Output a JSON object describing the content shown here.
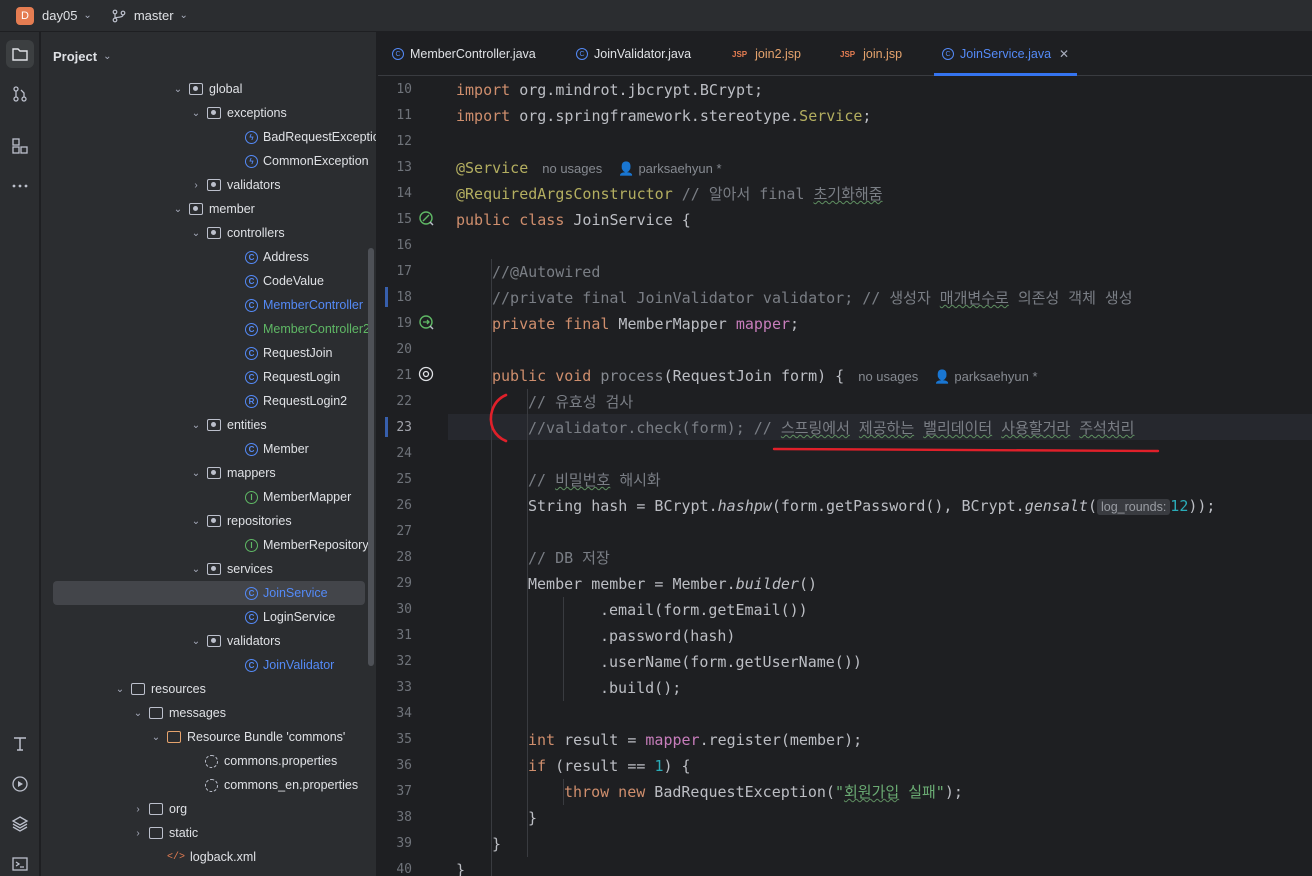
{
  "titlebar": {
    "project_badge": "D",
    "project_name": "day05",
    "branch": "master"
  },
  "leftbar": {
    "icons": [
      "folder-icon",
      "commit-icon",
      "structure-icon",
      "more-icon",
      "text-icon",
      "run-icon",
      "layers-icon",
      "terminal-icon"
    ]
  },
  "project_panel": {
    "title": "Project",
    "items": [
      {
        "label": "global",
        "type": "package",
        "expanded": true
      },
      {
        "label": "exceptions",
        "type": "package",
        "expanded": true
      },
      {
        "label": "BadRequestException",
        "type": "exception"
      },
      {
        "label": "CommonException",
        "type": "exception"
      },
      {
        "label": "validators",
        "type": "package",
        "expanded": false
      },
      {
        "label": "member",
        "type": "package",
        "expanded": true
      },
      {
        "label": "controllers",
        "type": "package",
        "expanded": true
      },
      {
        "label": "Address",
        "type": "class"
      },
      {
        "label": "CodeValue",
        "type": "class"
      },
      {
        "label": "MemberController",
        "type": "class",
        "color": "#548af7"
      },
      {
        "label": "MemberController2",
        "type": "class",
        "color": "#5fb865"
      },
      {
        "label": "RequestJoin",
        "type": "class"
      },
      {
        "label": "RequestLogin",
        "type": "class"
      },
      {
        "label": "RequestLogin2",
        "type": "record"
      },
      {
        "label": "entities",
        "type": "package",
        "expanded": true
      },
      {
        "label": "Member",
        "type": "class"
      },
      {
        "label": "mappers",
        "type": "package",
        "expanded": true
      },
      {
        "label": "MemberMapper",
        "type": "interface"
      },
      {
        "label": "repositories",
        "type": "package",
        "expanded": true
      },
      {
        "label": "MemberRepository",
        "type": "interface"
      },
      {
        "label": "services",
        "type": "package",
        "expanded": true
      },
      {
        "label": "JoinService",
        "type": "class",
        "color": "#548af7",
        "selected": true
      },
      {
        "label": "LoginService",
        "type": "class"
      },
      {
        "label": "validators",
        "type": "package",
        "expanded": true
      },
      {
        "label": "JoinValidator",
        "type": "class",
        "color": "#548af7"
      },
      {
        "label": "resources",
        "type": "folder",
        "expanded": true
      },
      {
        "label": "messages",
        "type": "folder",
        "expanded": true
      },
      {
        "label": "Resource Bundle 'commons'",
        "type": "bundle",
        "expanded": true
      },
      {
        "label": "commons.properties",
        "type": "properties"
      },
      {
        "label": "commons_en.properties",
        "type": "properties"
      },
      {
        "label": "org",
        "type": "folder",
        "expanded": false
      },
      {
        "label": "static",
        "type": "folder",
        "expanded": false
      },
      {
        "label": "logback.xml",
        "type": "xml"
      }
    ]
  },
  "tabs": [
    {
      "label": "MemberController.java",
      "kind": "java"
    },
    {
      "label": "JoinValidator.java",
      "kind": "java"
    },
    {
      "label": "join2.jsp",
      "kind": "jsp"
    },
    {
      "label": "join.jsp",
      "kind": "jsp"
    },
    {
      "label": "JoinService.java",
      "kind": "java",
      "active": true
    }
  ],
  "tab_jsp_badge": "JSP",
  "editor": {
    "line_numbers": [
      "10",
      "11",
      "12",
      "13",
      "14",
      "15",
      "16",
      "17",
      "18",
      "19",
      "20",
      "21",
      "22",
      "23",
      "24",
      "25",
      "26",
      "27",
      "28",
      "29",
      "30",
      "31",
      "32",
      "33",
      "34",
      "35",
      "36",
      "37",
      "38",
      "39",
      "40"
    ],
    "current_line": "23",
    "hints": {
      "no_usages": "no usages",
      "author": "parksaehyun *",
      "param_name": "log_rounds:"
    },
    "code": {
      "l10_kw": "import",
      "l10_rest": " org.mindrot.jbcrypt.BCrypt;",
      "l11_kw": "import",
      "l11_rest": " org.springframework.stereotype.",
      "l11_ann": "Service",
      "l11_end": ";",
      "l13_ann": "@Service",
      "l14_ann": "@RequiredArgsConstructor",
      "l14_cmt": " // 알아서 final ",
      "l14_cmt_sq": "초기화해줌",
      "l15_kw": "public class",
      "l15_rest": " JoinService {",
      "l17_cmt": "//@Autowired",
      "l18_cmt": "//private final JoinValidator validator; // 생성자 ",
      "l18_sq": "매개변수로",
      "l18_cmt2": " 의존성 객체 생성",
      "l19_kw": "private final",
      "l19_type": " MemberMapper ",
      "l19_fld": "mapper",
      "l19_end": ";",
      "l21_kw": "public void",
      "l21_fn": " process",
      "l21_rest": "(RequestJoin form) {",
      "l22_cmt": "// 유효성 검사",
      "l23_cmt": "//validator.check(form); // ",
      "l23_sq1": "스프링에서",
      "l23_sp1": " ",
      "l23_sq2": "제공하는",
      "l23_sp2": " ",
      "l23_sq3": "밸리데이터",
      "l23_sp3": " ",
      "l23_sq4": "사용할거라",
      "l23_sp4": " ",
      "l23_sq5": "주석처리",
      "l25_cmt": "// ",
      "l25_sq": "비밀번호",
      "l25_cmt2": " 해시화",
      "l26_a": "String hash = BCrypt.",
      "l26_fn": "hashpw",
      "l26_b": "(form.getPassword(), BCrypt.",
      "l26_fn2": "gensalt",
      "l26_c": "(",
      "l26_num": "12",
      "l26_d": "));",
      "l28_cmt": "// DB 저장",
      "l29_a": "Member member = Member.",
      "l29_fn": "builder",
      "l29_b": "()",
      "l30": ".email(form.getEmail())",
      "l31": ".password(hash)",
      "l32": ".userName(form.getUserName())",
      "l33": ".build();",
      "l35_kw": "int",
      "l35_a": " result = ",
      "l35_fld": "mapper",
      "l35_b": ".register(member);",
      "l36_kw": "if",
      "l36_a": " (result == ",
      "l36_num": "1",
      "l36_b": ") {",
      "l37_kw": "throw new",
      "l37_a": " BadRequestException(",
      "l37_str1": "\"",
      "l37_sq": "회원가입",
      "l37_str2": " 실패\"",
      "l37_b": ");",
      "l38": "}",
      "l39": "}",
      "l40": "}"
    }
  },
  "colors": {
    "accent": "#3574f0",
    "annotation_red": "#e0202a",
    "background": "#1e1f22"
  }
}
